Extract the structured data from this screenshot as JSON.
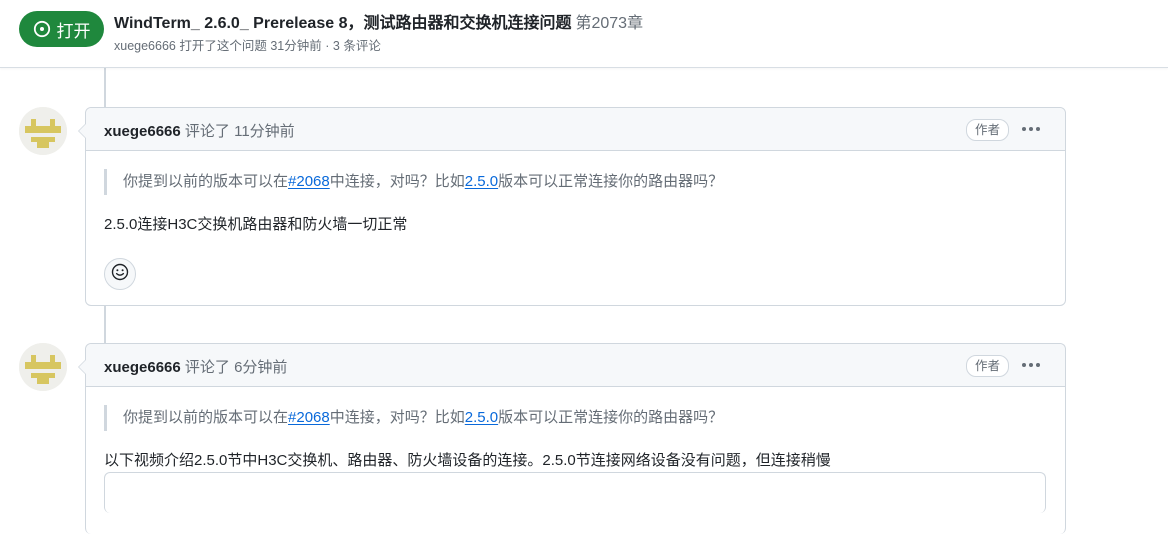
{
  "header": {
    "state_label": "打开",
    "title": "WindTerm_ 2.6.0_ Prerelease 8，测试路由器和交换机连接问题",
    "number": "第2073章",
    "meta": {
      "author": "xuege6666",
      "action": "打开了这个问题",
      "time": "31分钟前",
      "separator": "·",
      "comments": "3 条评论"
    }
  },
  "comments": [
    {
      "login": "xuege6666",
      "action": "评论了",
      "time": "11分钟前",
      "author_label": "作者",
      "quote": {
        "before": "你提到以前的版本可以在",
        "link1": "#2068",
        "middle": "中连接，对吗？比如",
        "link2": "2.5.0",
        "after": "版本可以正常连接你的路由器吗？"
      },
      "body": "2.5.0连接H3C交换机路由器和防火墙一切正常"
    },
    {
      "login": "xuege6666",
      "action": "评论了",
      "time": "6分钟前",
      "author_label": "作者",
      "quote": {
        "before": "你提到以前的版本可以在",
        "link1": "#2068",
        "middle": "中连接，对吗？比如",
        "link2": "2.5.0",
        "after": "版本可以正常连接你的路由器吗？"
      },
      "body": "以下视频介绍2.5.0节中H3C交换机、路由器、防火墙设备的连接。2.5.0节连接网络设备没有问题，但连接稍慢"
    }
  ],
  "icons": {
    "state": "issue-opened-icon",
    "kebab": "kebab-horizontal-icon",
    "reaction": "smiley-icon"
  },
  "colors": {
    "open_green": "#1f883d",
    "link_blue": "#0969da",
    "muted": "#656d76",
    "border": "#d0d7de",
    "header_bg": "#f6f8fa"
  }
}
